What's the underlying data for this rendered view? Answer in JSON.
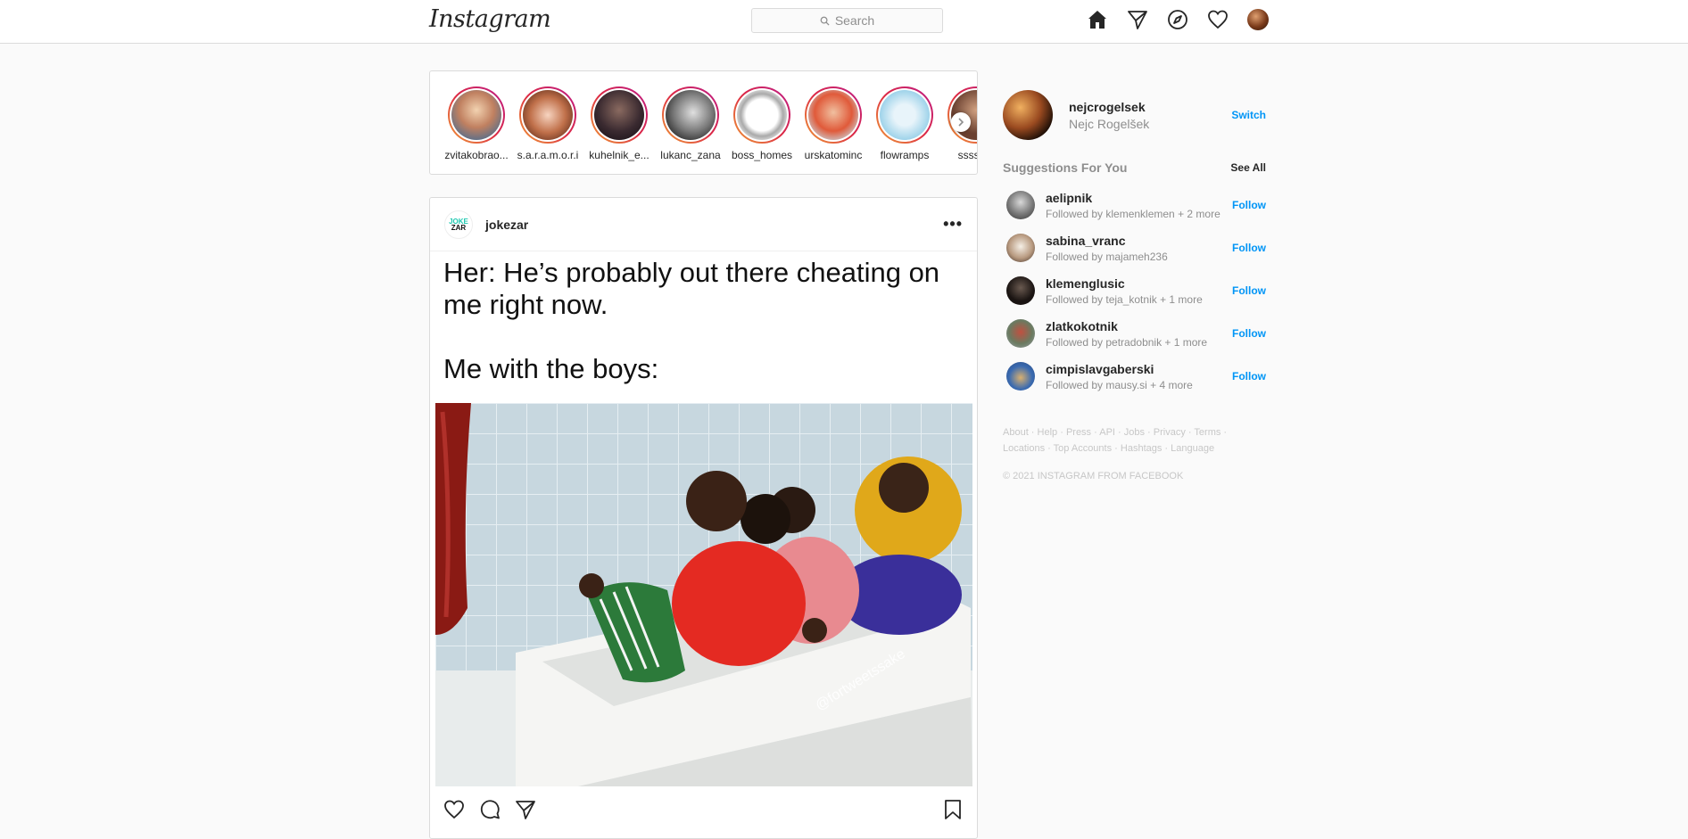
{
  "header": {
    "logo": "Instagram",
    "search_placeholder": "Search",
    "icons": [
      "home-icon",
      "direct-icon",
      "explore-icon",
      "activity-icon",
      "profile-avatar"
    ]
  },
  "stories": [
    {
      "name": "zvitakobrao..."
    },
    {
      "name": "s.a.r.a.m.o.r.i"
    },
    {
      "name": "kuhelnik_e..."
    },
    {
      "name": "lukanc_zana"
    },
    {
      "name": "boss_homes"
    },
    {
      "name": "urskatominc"
    },
    {
      "name": "flowramps"
    },
    {
      "name": "ssssa..."
    }
  ],
  "post": {
    "username": "jokezar",
    "avatar_text_top": "JOKE",
    "avatar_text_bottom": "ZAR",
    "caption_line1": "Her: He’s probably out there cheating on me right now.",
    "caption_line2": "Me with the boys:",
    "watermark": "@fortweetssake"
  },
  "sidebar": {
    "username": "nejcrogelsek",
    "fullname": "Nejc Rogelšek",
    "switch_label": "Switch",
    "suggestions_title": "Suggestions For You",
    "see_all_label": "See All",
    "suggestions": [
      {
        "name": "aelipnik",
        "sub": "Followed by klemenklemen + 2 more",
        "action": "Follow"
      },
      {
        "name": "sabina_vranc",
        "sub": "Followed by majameh236",
        "action": "Follow"
      },
      {
        "name": "klemenglusic",
        "sub": "Followed by teja_kotnik + 1 more",
        "action": "Follow"
      },
      {
        "name": "zlatkokotnik",
        "sub": "Followed by petradobnik + 1 more",
        "action": "Follow"
      },
      {
        "name": "cimpislavgaberski",
        "sub": "Followed by mausy.si + 4 more",
        "action": "Follow"
      }
    ],
    "footer": {
      "row1": [
        "About",
        "Help",
        "Press",
        "API",
        "Jobs",
        "Privacy",
        "Terms"
      ],
      "row2": [
        "Locations",
        "Top Accounts",
        "Hashtags",
        "Language"
      ],
      "copyright": "© 2021 INSTAGRAM FROM FACEBOOK"
    }
  }
}
